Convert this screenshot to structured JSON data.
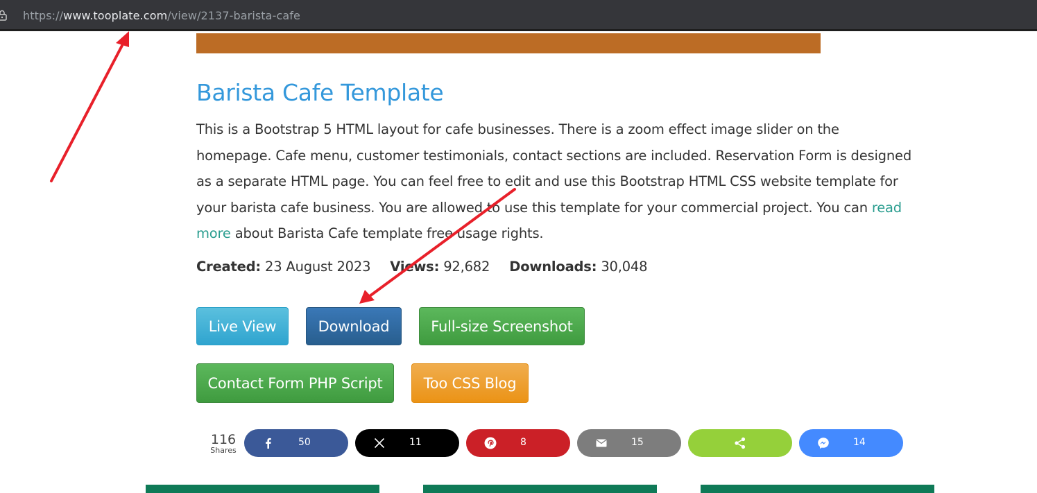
{
  "browser": {
    "url_scheme": "https://",
    "url_host": "www.tooplate.com",
    "url_path": "/view/2137-barista-cafe"
  },
  "page": {
    "title": "Barista Cafe Template",
    "description_before_link": "This is a Bootstrap 5 HTML layout for cafe businesses. There is a zoom effect image slider on the homepage. Cafe menu, customer testimonials, contact sections are included. Reservation Form is designed as a separate HTML page. You can feel free to edit and use this Bootstrap HTML CSS website template for your barista cafe business. You are allowed to use this template for your commercial project. You can ",
    "description_link": "read more",
    "description_after_link": " about Barista Cafe template free usage rights.",
    "meta": {
      "created_label": "Created:",
      "created_value": "23 August 2023",
      "views_label": "Views:",
      "views_value": "92,682",
      "downloads_label": "Downloads:",
      "downloads_value": "30,048"
    }
  },
  "buttons": {
    "live_view": "Live View",
    "download": "Download",
    "screenshot": "Full-size Screenshot",
    "contact_form": "Contact Form PHP Script",
    "blog": "Too CSS Blog"
  },
  "share": {
    "total": "116",
    "total_label": "Shares",
    "facebook": "50",
    "x": "11",
    "pinterest": "8",
    "email": "15",
    "messenger": "14"
  },
  "colors": {
    "accent_blue": "#3498db",
    "hero_brown": "#bc6c25",
    "annotation_red": "#e8202a"
  }
}
